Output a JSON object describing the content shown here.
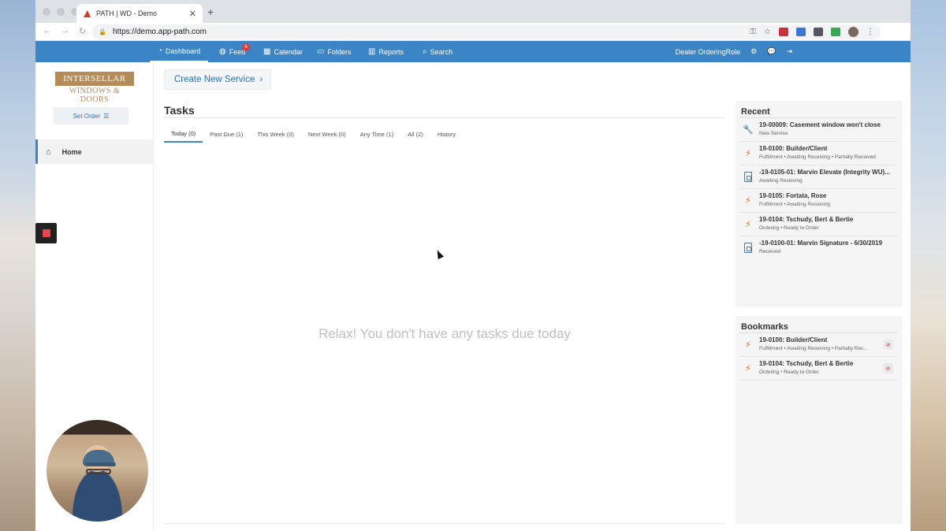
{
  "browser": {
    "tab_title": "PATH | WD - Demo",
    "url": "https://demo.app-path.com"
  },
  "nav": {
    "items": [
      {
        "label": "Dashboard"
      },
      {
        "label": "Feed",
        "badge": "6"
      },
      {
        "label": "Calendar"
      },
      {
        "label": "Folders"
      },
      {
        "label": "Reports"
      },
      {
        "label": "Search"
      }
    ],
    "role": "Dealer OrderingRole"
  },
  "sidebar": {
    "logo_line1": "INTERSELLAR",
    "logo_line2": "WINDOWS & DOORS",
    "set_order": "Set Order",
    "home": "Home"
  },
  "main": {
    "create_button": "Create New Service",
    "tasks_title": "Tasks",
    "tabs": [
      {
        "label": "Today (0)"
      },
      {
        "label": "Past Due (1)"
      },
      {
        "label": "This Week (0)"
      },
      {
        "label": "Next Week (0)"
      },
      {
        "label": "Any Time (1)"
      },
      {
        "label": "All (2)"
      },
      {
        "label": "History"
      }
    ],
    "empty_message": "Relax! You don't have any tasks due today"
  },
  "recent": {
    "title": "Recent",
    "items": [
      {
        "title": "19-00009: Casement window won't close",
        "subtitle": "New Service",
        "icon": "wrench-icon"
      },
      {
        "title": "19-0100: Builder/Client",
        "subtitle": "Fulfillment • Awaiting Receiving • Partially Received",
        "icon": "bolt-icon"
      },
      {
        "title": "-19-0105-01: Marvin Elevate (Integrity WU)...",
        "subtitle": "Awaiting Receiving",
        "icon": "document-icon"
      },
      {
        "title": "19-0105: Fortata, Rose",
        "subtitle": "Fulfillment • Awaiting Receiving",
        "icon": "bolt-icon"
      },
      {
        "title": "19-0104: Tschudy, Bert & Bertie",
        "subtitle": "Ordering • Ready to Order",
        "icon": "bolt-icon"
      },
      {
        "title": "-19-0100-01: Marvin Signature - 6/30/2019",
        "subtitle": "Received",
        "icon": "document-icon"
      }
    ]
  },
  "bookmarks": {
    "title": "Bookmarks",
    "items": [
      {
        "title": "19-0100: Builder/Client",
        "subtitle": "Fulfillment • Awaiting Receiving • Partially Rec..."
      },
      {
        "title": "19-0104: Tschudy, Bert & Bertie",
        "subtitle": "Ordering • Ready to Order"
      }
    ]
  },
  "colors": {
    "brand_blue": "#3b85c7",
    "logo_gold": "#b58c57",
    "badge_red": "#e53935",
    "bolt_orange": "#e0712a"
  }
}
